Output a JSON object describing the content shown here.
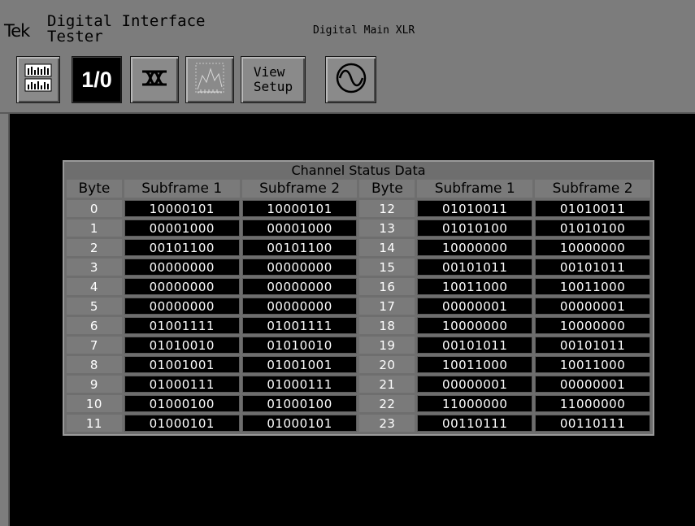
{
  "header": {
    "brand": "Tek",
    "product_line1": "Digital Interface",
    "product_line2": "Tester",
    "context": "Digital Main XLR"
  },
  "toolbar": {
    "buttons": [
      {
        "icon": "level-meters-icon"
      },
      {
        "label": "1/0",
        "active": true
      },
      {
        "icon": "eye-pattern-icon"
      },
      {
        "icon": "spectrum-graph-icon"
      },
      {
        "label_line1": "View",
        "label_line2": "Setup"
      },
      {
        "icon": "sine-wave-icon"
      }
    ]
  },
  "table": {
    "title": "Channel Status Data",
    "headers": [
      "Byte",
      "Subframe 1",
      "Subframe 2",
      "Byte",
      "Subframe 1",
      "Subframe 2"
    ],
    "rows": [
      [
        "0",
        "10000101",
        "10000101",
        "12",
        "01010011",
        "01010011"
      ],
      [
        "1",
        "00001000",
        "00001000",
        "13",
        "01010100",
        "01010100"
      ],
      [
        "2",
        "00101100",
        "00101100",
        "14",
        "10000000",
        "10000000"
      ],
      [
        "3",
        "00000000",
        "00000000",
        "15",
        "00101011",
        "00101011"
      ],
      [
        "4",
        "00000000",
        "00000000",
        "16",
        "10011000",
        "10011000"
      ],
      [
        "5",
        "00000000",
        "00000000",
        "17",
        "00000001",
        "00000001"
      ],
      [
        "6",
        "01001111",
        "01001111",
        "18",
        "10000000",
        "10000000"
      ],
      [
        "7",
        "01010010",
        "01010010",
        "19",
        "00101011",
        "00101011"
      ],
      [
        "8",
        "01001001",
        "01001001",
        "20",
        "10011000",
        "10011000"
      ],
      [
        "9",
        "01000111",
        "01000111",
        "21",
        "00000001",
        "00000001"
      ],
      [
        "10",
        "01000100",
        "01000100",
        "22",
        "11000000",
        "11000000"
      ],
      [
        "11",
        "01000101",
        "01000101",
        "23",
        "00110111",
        "00110111"
      ]
    ]
  }
}
